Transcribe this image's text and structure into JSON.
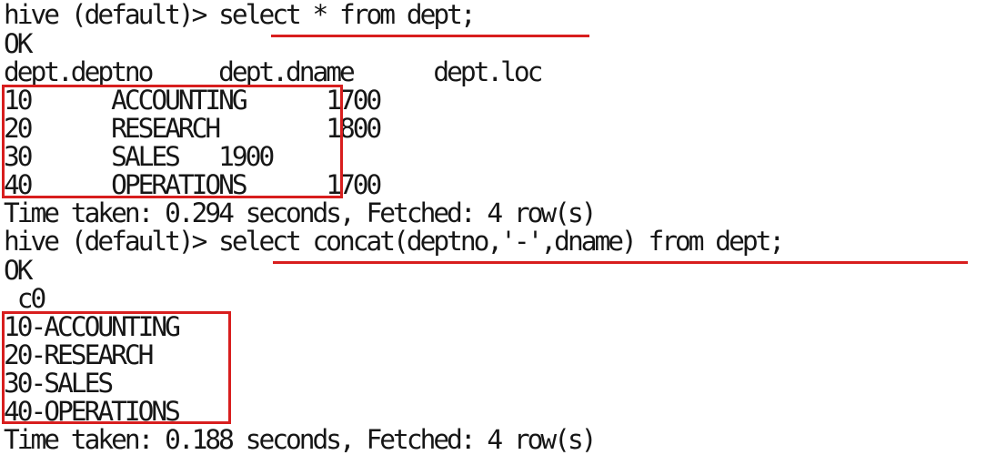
{
  "terminal": {
    "lines": [
      "hive (default)> select * from dept;",
      "OK",
      "dept.deptno     dept.dname      dept.loc",
      "10      ACCOUNTING      1700",
      "20      RESEARCH        1800",
      "30      SALES   1900",
      "40      OPERATIONS      1700",
      "Time taken: 0.294 seconds, Fetched: 4 row(s)",
      "hive (default)> select concat(deptno,'-',dname) from dept;",
      "OK",
      "_c0",
      "10-ACCOUNTING",
      "20-RESEARCH",
      "30-SALES",
      "40-OPERATIONS",
      "Time taken: 0.188 seconds, Fetched: 4 row(s)"
    ]
  },
  "colors": {
    "text": "#161616",
    "highlight": "#d81e1e",
    "background": "#ffffff"
  }
}
